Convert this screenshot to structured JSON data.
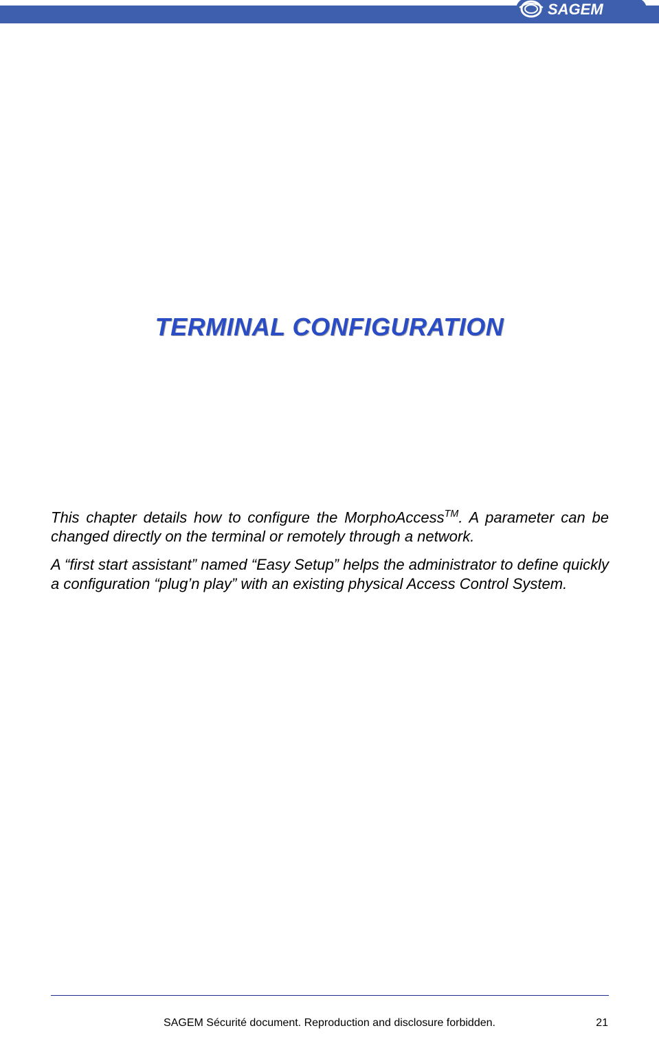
{
  "header": {
    "brand": "SAGEM"
  },
  "title": "TERMINAL CONFIGURATION",
  "paragraphs": {
    "p1_a": "This chapter details how to configure the MorphoAccess",
    "p1_tm": "TM",
    "p1_b": ". A parameter can be changed directly on the terminal or remotely through a network.",
    "p2": "A “first start assistant” named “Easy Setup” helps the administrator to define quickly a configuration “plug’n play” with an existing physical Access Control System."
  },
  "footer": {
    "notice": "SAGEM Sécurité document. Reproduction and disclosure forbidden.",
    "page": "21"
  }
}
